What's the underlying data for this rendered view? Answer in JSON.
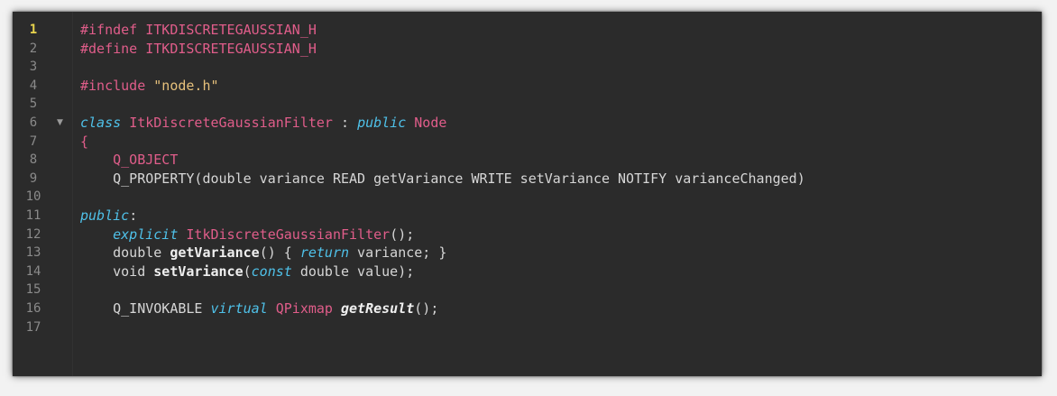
{
  "editor": {
    "current_line": 1,
    "lines": [
      {
        "n": "1",
        "parts": [
          {
            "c": "pp",
            "t": "#ifndef ITKDISCRETEGAUSSIAN_H"
          }
        ]
      },
      {
        "n": "2",
        "parts": [
          {
            "c": "pp",
            "t": "#define ITKDISCRETEGAUSSIAN_H"
          }
        ]
      },
      {
        "n": "3",
        "parts": []
      },
      {
        "n": "4",
        "parts": [
          {
            "c": "pp",
            "t": "#include "
          },
          {
            "c": "str",
            "t": "\"node.h\""
          }
        ]
      },
      {
        "n": "5",
        "parts": []
      },
      {
        "n": "6",
        "fold": "▼",
        "parts": [
          {
            "c": "kw",
            "t": "class"
          },
          {
            "c": "plain",
            "t": " "
          },
          {
            "c": "type",
            "t": "ItkDiscreteGaussianFilter"
          },
          {
            "c": "plain",
            "t": " : "
          },
          {
            "c": "kw",
            "t": "public"
          },
          {
            "c": "plain",
            "t": " "
          },
          {
            "c": "type",
            "t": "Node"
          }
        ]
      },
      {
        "n": "7",
        "parts": [
          {
            "c": "type",
            "t": "{"
          }
        ]
      },
      {
        "n": "8",
        "parts": [
          {
            "c": "plain",
            "t": "    "
          },
          {
            "c": "macro",
            "t": "Q_OBJECT"
          }
        ]
      },
      {
        "n": "9",
        "parts": [
          {
            "c": "plain",
            "t": "    Q_PROPERTY(double variance READ getVariance WRITE setVariance NOTIFY varianceChanged)"
          }
        ]
      },
      {
        "n": "10",
        "parts": []
      },
      {
        "n": "11",
        "parts": [
          {
            "c": "kw",
            "t": "public"
          },
          {
            "c": "plain",
            "t": ":"
          }
        ]
      },
      {
        "n": "12",
        "parts": [
          {
            "c": "plain",
            "t": "    "
          },
          {
            "c": "kw",
            "t": "explicit"
          },
          {
            "c": "plain",
            "t": " "
          },
          {
            "c": "type",
            "t": "ItkDiscreteGaussianFilter"
          },
          {
            "c": "plain",
            "t": "();"
          }
        ]
      },
      {
        "n": "13",
        "parts": [
          {
            "c": "plain",
            "t": "    double "
          },
          {
            "c": "fn",
            "t": "getVariance"
          },
          {
            "c": "plain",
            "t": "() { "
          },
          {
            "c": "kw",
            "t": "return"
          },
          {
            "c": "plain",
            "t": " variance; }"
          }
        ]
      },
      {
        "n": "14",
        "parts": [
          {
            "c": "plain",
            "t": "    void "
          },
          {
            "c": "fn",
            "t": "setVariance"
          },
          {
            "c": "plain",
            "t": "("
          },
          {
            "c": "kw",
            "t": "const"
          },
          {
            "c": "plain",
            "t": " double value);"
          }
        ]
      },
      {
        "n": "15",
        "parts": []
      },
      {
        "n": "16",
        "parts": [
          {
            "c": "plain",
            "t": "    Q_INVOKABLE "
          },
          {
            "c": "kw",
            "t": "virtual"
          },
          {
            "c": "plain",
            "t": " "
          },
          {
            "c": "type",
            "t": "QPixmap"
          },
          {
            "c": "plain",
            "t": " "
          },
          {
            "c": "fni",
            "t": "getResult"
          },
          {
            "c": "plain",
            "t": "();"
          }
        ]
      },
      {
        "n": "17",
        "parts": []
      }
    ]
  }
}
